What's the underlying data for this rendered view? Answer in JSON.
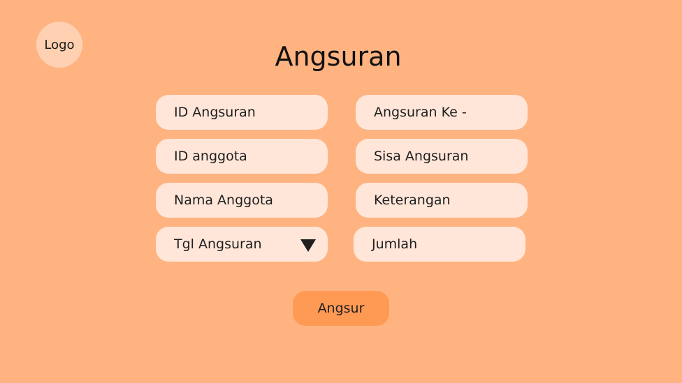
{
  "logo": {
    "label": "Logo"
  },
  "page": {
    "title": "Angsuran"
  },
  "form": {
    "id_angsuran": "ID Angsuran",
    "angsuran_ke": "Angsuran Ke -",
    "id_anggota": "ID anggota",
    "sisa_angsuran": "Sisa Angsuran",
    "nama_anggota": "Nama Anggota",
    "keterangan": "Keterangan",
    "tgl_angsuran": "Tgl Angsuran",
    "jumlah": "Jumlah"
  },
  "actions": {
    "submit_label": "Angsur"
  },
  "icons": {
    "dropdown": "triangle-down-icon"
  },
  "colors": {
    "background": "#FFB380",
    "field": "#FFE6D9",
    "logo": "#FFD1B2",
    "button": "#FF9A55"
  }
}
